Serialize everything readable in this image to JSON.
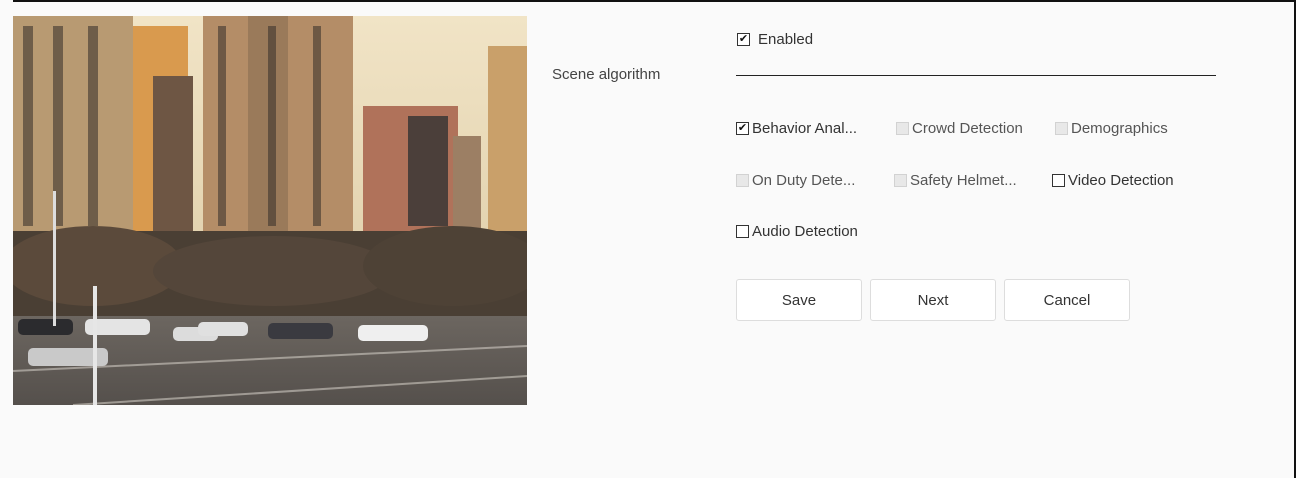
{
  "preview": {
    "alt": "camera preview"
  },
  "scene": {
    "label": "Scene algorithm",
    "enabled": {
      "label": "Enabled",
      "checked": true
    }
  },
  "algorithms": [
    {
      "label": "Behavior Anal...",
      "checked": true,
      "disabled": false
    },
    {
      "label": "Crowd Detection",
      "checked": false,
      "disabled": true
    },
    {
      "label": "Demographics",
      "checked": false,
      "disabled": true
    },
    {
      "label": "On Duty Dete...",
      "checked": false,
      "disabled": true
    },
    {
      "label": "Safety Helmet...",
      "checked": false,
      "disabled": true
    },
    {
      "label": "Video Detection",
      "checked": false,
      "disabled": false
    },
    {
      "label": "Audio Detection",
      "checked": false,
      "disabled": false
    }
  ],
  "buttons": {
    "save": "Save",
    "next": "Next",
    "cancel": "Cancel"
  }
}
